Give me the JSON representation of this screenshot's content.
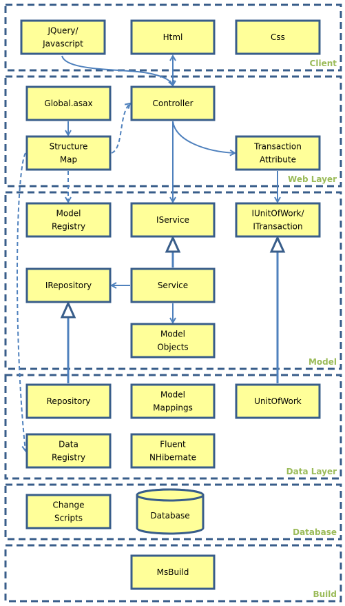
{
  "colors": {
    "box_fill": "#FFFF99",
    "box_border": "#385D8A",
    "connector": "#4F81BD",
    "layer_label": "#9BBB59"
  },
  "layers": [
    {
      "id": "client",
      "label": "Client"
    },
    {
      "id": "web",
      "label": "Web Layer"
    },
    {
      "id": "model",
      "label": "Model"
    },
    {
      "id": "data",
      "label": "Data Layer"
    },
    {
      "id": "database",
      "label": "Database"
    },
    {
      "id": "build",
      "label": "Build"
    }
  ],
  "boxes": [
    {
      "id": "jquery",
      "lines": [
        "JQuery/",
        "Javascript"
      ]
    },
    {
      "id": "html",
      "lines": [
        "Html"
      ]
    },
    {
      "id": "css",
      "lines": [
        "Css"
      ]
    },
    {
      "id": "global",
      "lines": [
        "Global.asax"
      ]
    },
    {
      "id": "controller",
      "lines": [
        "Controller"
      ]
    },
    {
      "id": "structuremap",
      "lines": [
        "Structure",
        "Map"
      ]
    },
    {
      "id": "transaction",
      "lines": [
        "Transaction",
        "Attribute"
      ]
    },
    {
      "id": "modelregistry",
      "lines": [
        "Model",
        "Registry"
      ]
    },
    {
      "id": "iservice",
      "lines": [
        "IService"
      ]
    },
    {
      "id": "iunitofwork",
      "lines": [
        "IUnitOfWork/",
        "ITransaction"
      ]
    },
    {
      "id": "irepository",
      "lines": [
        "IRepository"
      ]
    },
    {
      "id": "service",
      "lines": [
        "Service"
      ]
    },
    {
      "id": "modelobjects",
      "lines": [
        "Model",
        "Objects"
      ]
    },
    {
      "id": "repository",
      "lines": [
        "Repository"
      ]
    },
    {
      "id": "modelmappings",
      "lines": [
        "Model",
        "Mappings"
      ]
    },
    {
      "id": "unitofwork",
      "lines": [
        "UnitOfWork"
      ]
    },
    {
      "id": "dataregistry",
      "lines": [
        "Data",
        "Registry"
      ]
    },
    {
      "id": "fluent",
      "lines": [
        "Fluent",
        "NHibernate"
      ]
    },
    {
      "id": "changescripts",
      "lines": [
        "Change",
        "Scripts"
      ]
    },
    {
      "id": "database",
      "lines": [
        "Database"
      ],
      "shape": "cylinder"
    },
    {
      "id": "msbuild",
      "lines": [
        "MsBuild"
      ]
    }
  ],
  "connections": [
    {
      "from": "jquery",
      "to": "controller",
      "style": "solid"
    },
    {
      "from": "html",
      "to": "controller",
      "style": "solid",
      "bidirectional": true
    },
    {
      "from": "global",
      "to": "structuremap",
      "style": "solid"
    },
    {
      "from": "structuremap",
      "to": "controller",
      "style": "dashed"
    },
    {
      "from": "structuremap",
      "to": "modelregistry",
      "style": "dashed"
    },
    {
      "from": "structuremap",
      "to": "dataregistry",
      "style": "dashed"
    },
    {
      "from": "controller",
      "to": "transaction",
      "style": "solid"
    },
    {
      "from": "controller",
      "to": "iservice",
      "style": "solid"
    },
    {
      "from": "transaction",
      "to": "iunitofwork",
      "style": "solid"
    },
    {
      "from": "service",
      "to": "iservice",
      "style": "inheritance"
    },
    {
      "from": "service",
      "to": "irepository",
      "style": "solid"
    },
    {
      "from": "service",
      "to": "modelobjects",
      "style": "solid"
    },
    {
      "from": "repository",
      "to": "irepository",
      "style": "inheritance"
    },
    {
      "from": "unitofwork",
      "to": "iunitofwork",
      "style": "inheritance"
    }
  ]
}
